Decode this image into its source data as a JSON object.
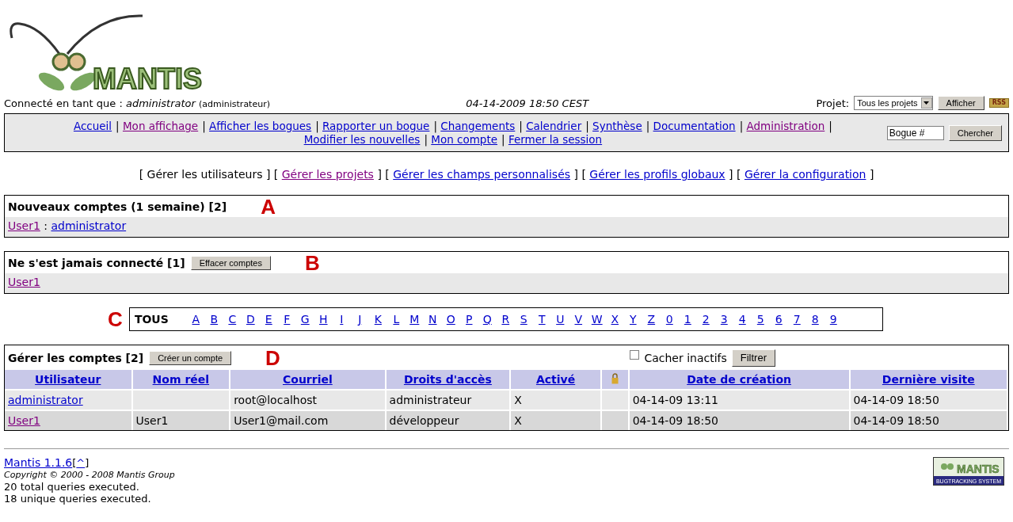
{
  "header": {
    "logo_text": "MANTIS",
    "login_label": "Connecté en tant que :",
    "username": "administrator",
    "role": "(administrateur)",
    "datetime": "04-14-2009 18:50 CEST",
    "project_label": "Projet:",
    "project_value": "Tous les projets",
    "show_button": "Afficher",
    "rss": "RSS"
  },
  "menu": {
    "separator": "|",
    "items": [
      {
        "label": "Accueil",
        "visited": false
      },
      {
        "label": "Mon affichage",
        "visited": true
      },
      {
        "label": "Afficher les bogues",
        "visited": false
      },
      {
        "label": "Rapporter un bogue",
        "visited": false
      },
      {
        "label": "Changements",
        "visited": false
      },
      {
        "label": "Calendrier",
        "visited": false
      },
      {
        "label": "Synthèse",
        "visited": false
      },
      {
        "label": "Documentation",
        "visited": false
      },
      {
        "label": "Administration",
        "visited": true
      },
      {
        "label": "Modifier les nouvelles",
        "visited": false
      },
      {
        "label": "Mon compte",
        "visited": false
      },
      {
        "label": "Fermer la session",
        "visited": false
      }
    ],
    "search": {
      "value": "Bogue #"
    },
    "search_button": "Chercher"
  },
  "admin_menu": {
    "open": "[",
    "close": "]",
    "items": [
      {
        "label": "Gérer les utilisateurs",
        "selected": true,
        "visited": false
      },
      {
        "label": "Gérer les projets",
        "selected": false,
        "visited": true
      },
      {
        "label": "Gérer les champs personnalisés",
        "selected": false,
        "visited": false
      },
      {
        "label": "Gérer les profils globaux",
        "selected": false,
        "visited": false
      },
      {
        "label": "Gérer la configuration",
        "selected": false,
        "visited": false
      }
    ]
  },
  "new_accounts": {
    "title": "Nouveaux comptes (1 semaine) [2]",
    "marker": "A",
    "separator": ":",
    "users": [
      {
        "label": "User1",
        "visited": true
      },
      {
        "label": "administrator",
        "visited": false
      }
    ]
  },
  "never_logged": {
    "title": "Ne s'est jamais connecté [1]",
    "button": "Effacer comptes",
    "marker": "B",
    "users": [
      {
        "label": "User1",
        "visited": true
      }
    ]
  },
  "letter_filter": {
    "marker": "C",
    "items": [
      {
        "label": "TOUS",
        "selected": true
      },
      {
        "label": "A",
        "selected": false
      },
      {
        "label": "B",
        "selected": false
      },
      {
        "label": "C",
        "selected": false
      },
      {
        "label": "D",
        "selected": false
      },
      {
        "label": "E",
        "selected": false
      },
      {
        "label": "F",
        "selected": false
      },
      {
        "label": "G",
        "selected": false
      },
      {
        "label": "H",
        "selected": false
      },
      {
        "label": "I",
        "selected": false
      },
      {
        "label": "J",
        "selected": false
      },
      {
        "label": "K",
        "selected": false
      },
      {
        "label": "L",
        "selected": false
      },
      {
        "label": "M",
        "selected": false
      },
      {
        "label": "N",
        "selected": false
      },
      {
        "label": "O",
        "selected": false
      },
      {
        "label": "P",
        "selected": false
      },
      {
        "label": "Q",
        "selected": false
      },
      {
        "label": "R",
        "selected": false
      },
      {
        "label": "S",
        "selected": false
      },
      {
        "label": "T",
        "selected": false
      },
      {
        "label": "U",
        "selected": false
      },
      {
        "label": "V",
        "selected": false
      },
      {
        "label": "W",
        "selected": false
      },
      {
        "label": "X",
        "selected": false
      },
      {
        "label": "Y",
        "selected": false
      },
      {
        "label": "Z",
        "selected": false
      },
      {
        "label": "0",
        "selected": false
      },
      {
        "label": "1",
        "selected": false
      },
      {
        "label": "2",
        "selected": false
      },
      {
        "label": "3",
        "selected": false
      },
      {
        "label": "4",
        "selected": false
      },
      {
        "label": "5",
        "selected": false
      },
      {
        "label": "6",
        "selected": false
      },
      {
        "label": "7",
        "selected": false
      },
      {
        "label": "8",
        "selected": false
      },
      {
        "label": "9",
        "selected": false
      }
    ]
  },
  "accounts": {
    "title": "Gérer les comptes [2]",
    "button": "Créer un compte",
    "marker": "D",
    "hide_inactive": {
      "label": "Cacher inactifs",
      "checked": false
    },
    "filter_button": "Filtrer",
    "columns": [
      {
        "kind": "text",
        "label": "Utilisateur"
      },
      {
        "kind": "text",
        "label": "Nom réel"
      },
      {
        "kind": "text",
        "label": "Courriel"
      },
      {
        "kind": "text",
        "label": "Droits d'accès"
      },
      {
        "kind": "text",
        "label": "Activé"
      },
      {
        "kind": "icon"
      },
      {
        "kind": "text",
        "label": "Date de création"
      },
      {
        "kind": "text",
        "label": "Dernière visite"
      }
    ],
    "rows": [
      {
        "cells": [
          {
            "kind": "link",
            "text": "administrator",
            "visited": false
          },
          {},
          {
            "text": "root@localhost"
          },
          {
            "text": "administrateur"
          },
          {
            "text": "X"
          },
          {},
          {
            "text": "04-14-09 13:11"
          },
          {
            "text": "04-14-09 18:50"
          }
        ]
      },
      {
        "cells": [
          {
            "kind": "link",
            "text": "User1",
            "visited": true
          },
          {
            "text": "User1"
          },
          {
            "text": "User1@mail.com"
          },
          {
            "text": "développeur"
          },
          {
            "text": "X"
          },
          {},
          {
            "text": "04-14-09 18:50"
          },
          {
            "text": "04-14-09 18:50"
          }
        ]
      }
    ]
  },
  "footer": {
    "version_link": "Mantis 1.1.6",
    "open": "[",
    "top_link": "^",
    "close": "]",
    "copyright": "Copyright © 2000 - 2008 Mantis Group",
    "queries": [
      "20 total queries executed.",
      "18 unique queries executed."
    ],
    "logo_text": "MANTIS",
    "logo_subtitle": "BUGTRACKING SYSTEM"
  }
}
